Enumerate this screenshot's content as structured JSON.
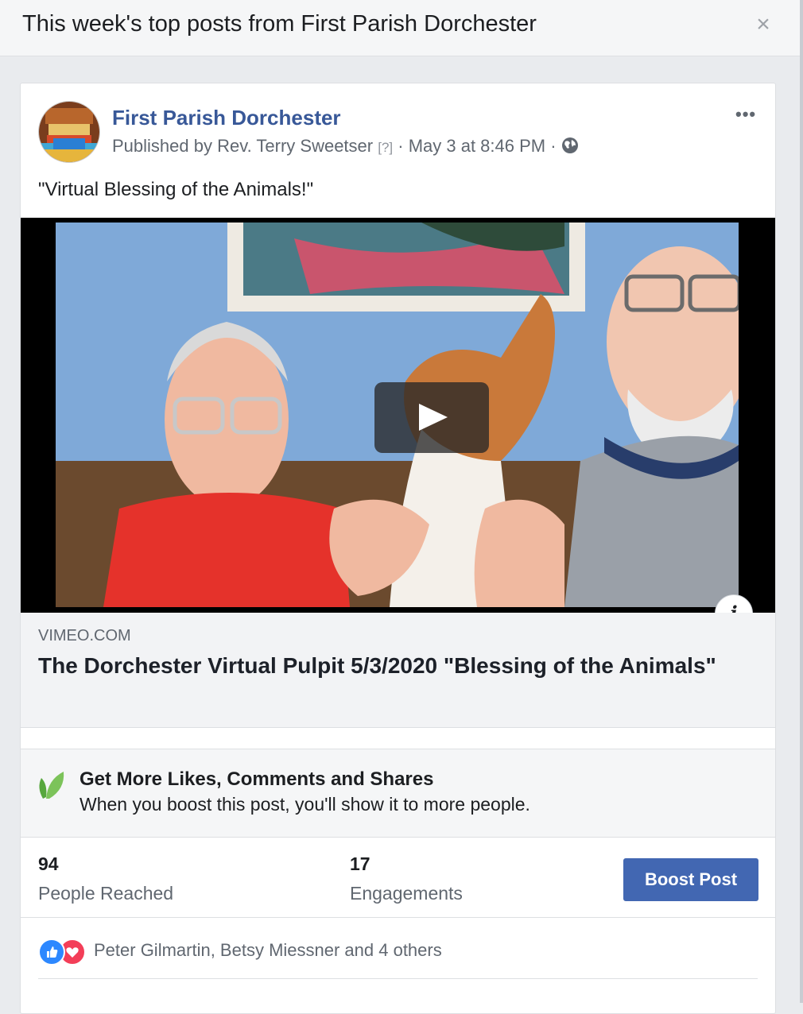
{
  "dialog": {
    "title": "This week's top posts from First Parish Dorchester",
    "close_label": "×"
  },
  "post": {
    "page_name": "First Parish Dorchester",
    "published_by": "Published by Rev. Terry Sweetser",
    "help_marker": "[?]",
    "separator": " · ",
    "timestamp": "May 3 at 8:46 PM",
    "audience_icon": "globe-icon",
    "more_label": "•••",
    "text": "\"Virtual Blessing of the Animals!\""
  },
  "video": {
    "play_icon": "play-icon",
    "info_label": "i"
  },
  "link": {
    "domain": "VIMEO.COM",
    "title": "The Dorchester Virtual Pulpit 5/3/2020 \"Blessing of the Animals\""
  },
  "boost": {
    "heading": "Get More Likes, Comments and Shares",
    "subtext": "When you boost this post, you'll show it to more people.",
    "button_label": "Boost Post",
    "accent_color": "#4267b2"
  },
  "stats": [
    {
      "value": "94",
      "label": "People Reached"
    },
    {
      "value": "17",
      "label": "Engagements"
    }
  ],
  "reactions": {
    "icons": [
      "like-icon",
      "love-icon"
    ],
    "text": "Peter Gilmartin, Betsy Miessner and 4 others"
  }
}
